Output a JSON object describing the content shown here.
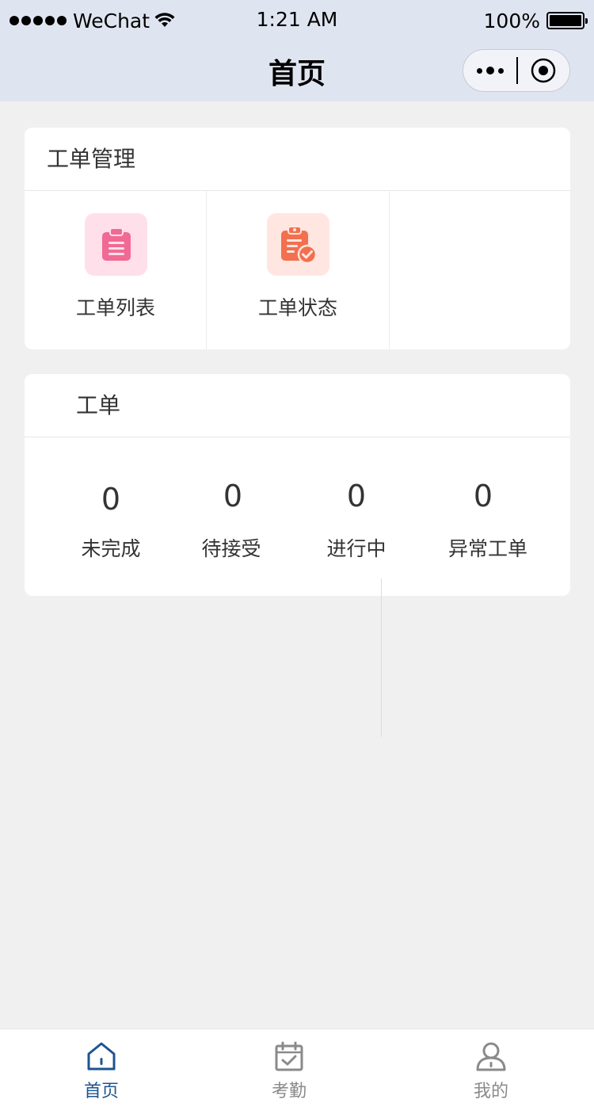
{
  "status_bar": {
    "carrier": "WeChat",
    "time": "1:21 AM",
    "battery": "100%"
  },
  "nav": {
    "title": "首页"
  },
  "work_order_management": {
    "title": "工单管理",
    "items": [
      {
        "label": "工单列表",
        "icon": "clipboard-list-icon",
        "color": "#f06a95"
      },
      {
        "label": "工单状态",
        "icon": "clipboard-check-icon",
        "color": "#f2704f"
      }
    ]
  },
  "work_orders": {
    "title": "工单",
    "stats": [
      {
        "value": "0",
        "label": "未完成"
      },
      {
        "value": "0",
        "label": "待接受"
      },
      {
        "value": "0",
        "label": "进行中"
      },
      {
        "value": "0",
        "label": "异常工单"
      }
    ]
  },
  "tabbar": {
    "active_color": "#1c5492",
    "inactive_color": "#8a8a8a",
    "tabs": [
      {
        "label": "首页",
        "icon": "home-icon",
        "active": true
      },
      {
        "label": "考勤",
        "icon": "calendar-check-icon",
        "active": false
      },
      {
        "label": "我的",
        "icon": "user-icon",
        "active": false
      }
    ]
  }
}
